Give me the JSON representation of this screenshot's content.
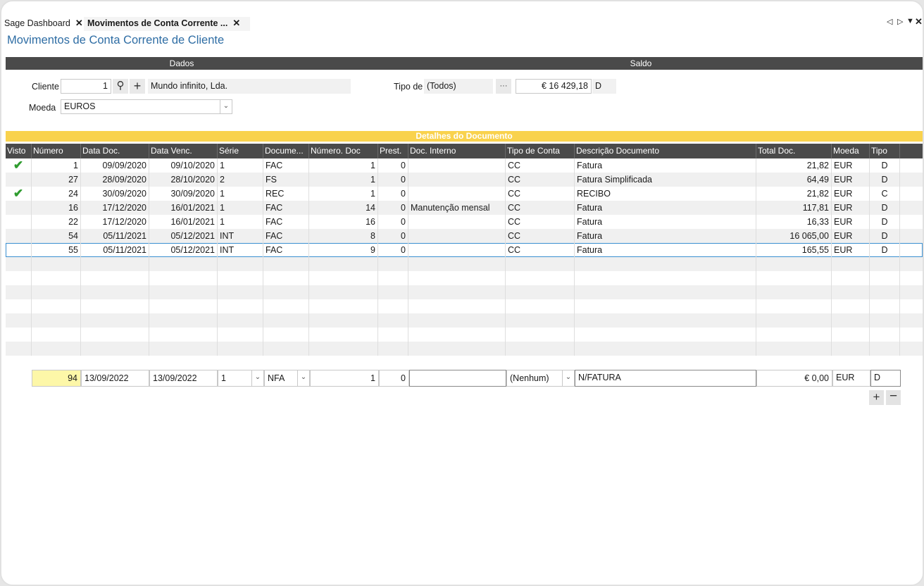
{
  "tabs": [
    {
      "label": "Sage Dashboard"
    },
    {
      "label": "Movimentos de Conta Corrente ..."
    }
  ],
  "page_title": "Movimentos de Conta Corrente de Cliente",
  "sections": {
    "dados": "Dados",
    "saldo": "Saldo",
    "detalhes": "Detalhes do Documento"
  },
  "form": {
    "cliente_label": "Cliente",
    "cliente_value": "1",
    "cliente_name": "Mundo infinito, Lda.",
    "moeda_label": "Moeda",
    "moeda_value": "EUROS",
    "tipo_label": "Tipo de",
    "tipo_value": "(Todos)",
    "ellipsis": "···",
    "saldo_value": "€ 16 429,18",
    "saldo_type": "D"
  },
  "columns": [
    "Visto",
    "Número",
    "Data Doc.",
    "Data Venc.",
    "Série",
    "Docume...",
    "Número. Doc",
    "Prest.",
    "Doc. Interno",
    "Tipo de Conta",
    "Descrição Documento",
    "Total Doc.",
    "Moeda",
    "Tipo"
  ],
  "rows": [
    {
      "visto": true,
      "numero": "1",
      "data_doc": "09/09/2020",
      "data_venc": "09/10/2020",
      "serie": "1",
      "documento": "FAC",
      "num_doc": "1",
      "prest": "0",
      "doc_interno": "",
      "tipo_conta": "CC",
      "descricao": "Fatura",
      "total": "21,82",
      "moeda": "EUR",
      "tipo": "D"
    },
    {
      "visto": false,
      "numero": "27",
      "data_doc": "28/09/2020",
      "data_venc": "28/10/2020",
      "serie": "2",
      "documento": "FS",
      "num_doc": "1",
      "prest": "0",
      "doc_interno": "",
      "tipo_conta": "CC",
      "descricao": "Fatura Simplificada",
      "total": "64,49",
      "moeda": "EUR",
      "tipo": "D"
    },
    {
      "visto": true,
      "numero": "24",
      "data_doc": "30/09/2020",
      "data_venc": "30/09/2020",
      "serie": "1",
      "documento": "REC",
      "num_doc": "1",
      "prest": "0",
      "doc_interno": "",
      "tipo_conta": "CC",
      "descricao": "RECIBO",
      "total": "21,82",
      "moeda": "EUR",
      "tipo": "C"
    },
    {
      "visto": false,
      "numero": "16",
      "data_doc": "17/12/2020",
      "data_venc": "16/01/2021",
      "serie": "1",
      "documento": "FAC",
      "num_doc": "14",
      "prest": "0",
      "doc_interno": "Manutenção mensal",
      "tipo_conta": "CC",
      "descricao": "Fatura",
      "total": "117,81",
      "moeda": "EUR",
      "tipo": "D"
    },
    {
      "visto": false,
      "numero": "22",
      "data_doc": "17/12/2020",
      "data_venc": "16/01/2021",
      "serie": "1",
      "documento": "FAC",
      "num_doc": "16",
      "prest": "0",
      "doc_interno": "",
      "tipo_conta": "CC",
      "descricao": "Fatura",
      "total": "16,33",
      "moeda": "EUR",
      "tipo": "D"
    },
    {
      "visto": false,
      "numero": "54",
      "data_doc": "05/11/2021",
      "data_venc": "05/12/2021",
      "serie": "INT",
      "documento": "FAC",
      "num_doc": "8",
      "prest": "0",
      "doc_interno": "",
      "tipo_conta": "CC",
      "descricao": "Fatura",
      "total": "16 065,00",
      "moeda": "EUR",
      "tipo": "D"
    },
    {
      "visto": false,
      "numero": "55",
      "data_doc": "05/11/2021",
      "data_venc": "05/12/2021",
      "serie": "INT",
      "documento": "FAC",
      "num_doc": "9",
      "prest": "0",
      "doc_interno": "",
      "tipo_conta": "CC",
      "descricao": "Fatura",
      "total": "165,55",
      "moeda": "EUR",
      "tipo": "D"
    }
  ],
  "entry": {
    "numero": "94",
    "data_doc": "13/09/2022",
    "data_venc": "13/09/2022",
    "serie": "1",
    "documento": "NFA",
    "num_doc": "1",
    "prest": "0",
    "doc_interno": "",
    "tipo_conta": "(Nenhum)",
    "descricao": "N/FATURA",
    "total": "€ 0,00",
    "moeda": "EUR",
    "tipo": "D"
  },
  "colors": {
    "header_dark": "#4a4a4a",
    "accent_yellow": "#f9d24d",
    "title_blue": "#2e6da4",
    "check_green": "#2f9c2f"
  }
}
